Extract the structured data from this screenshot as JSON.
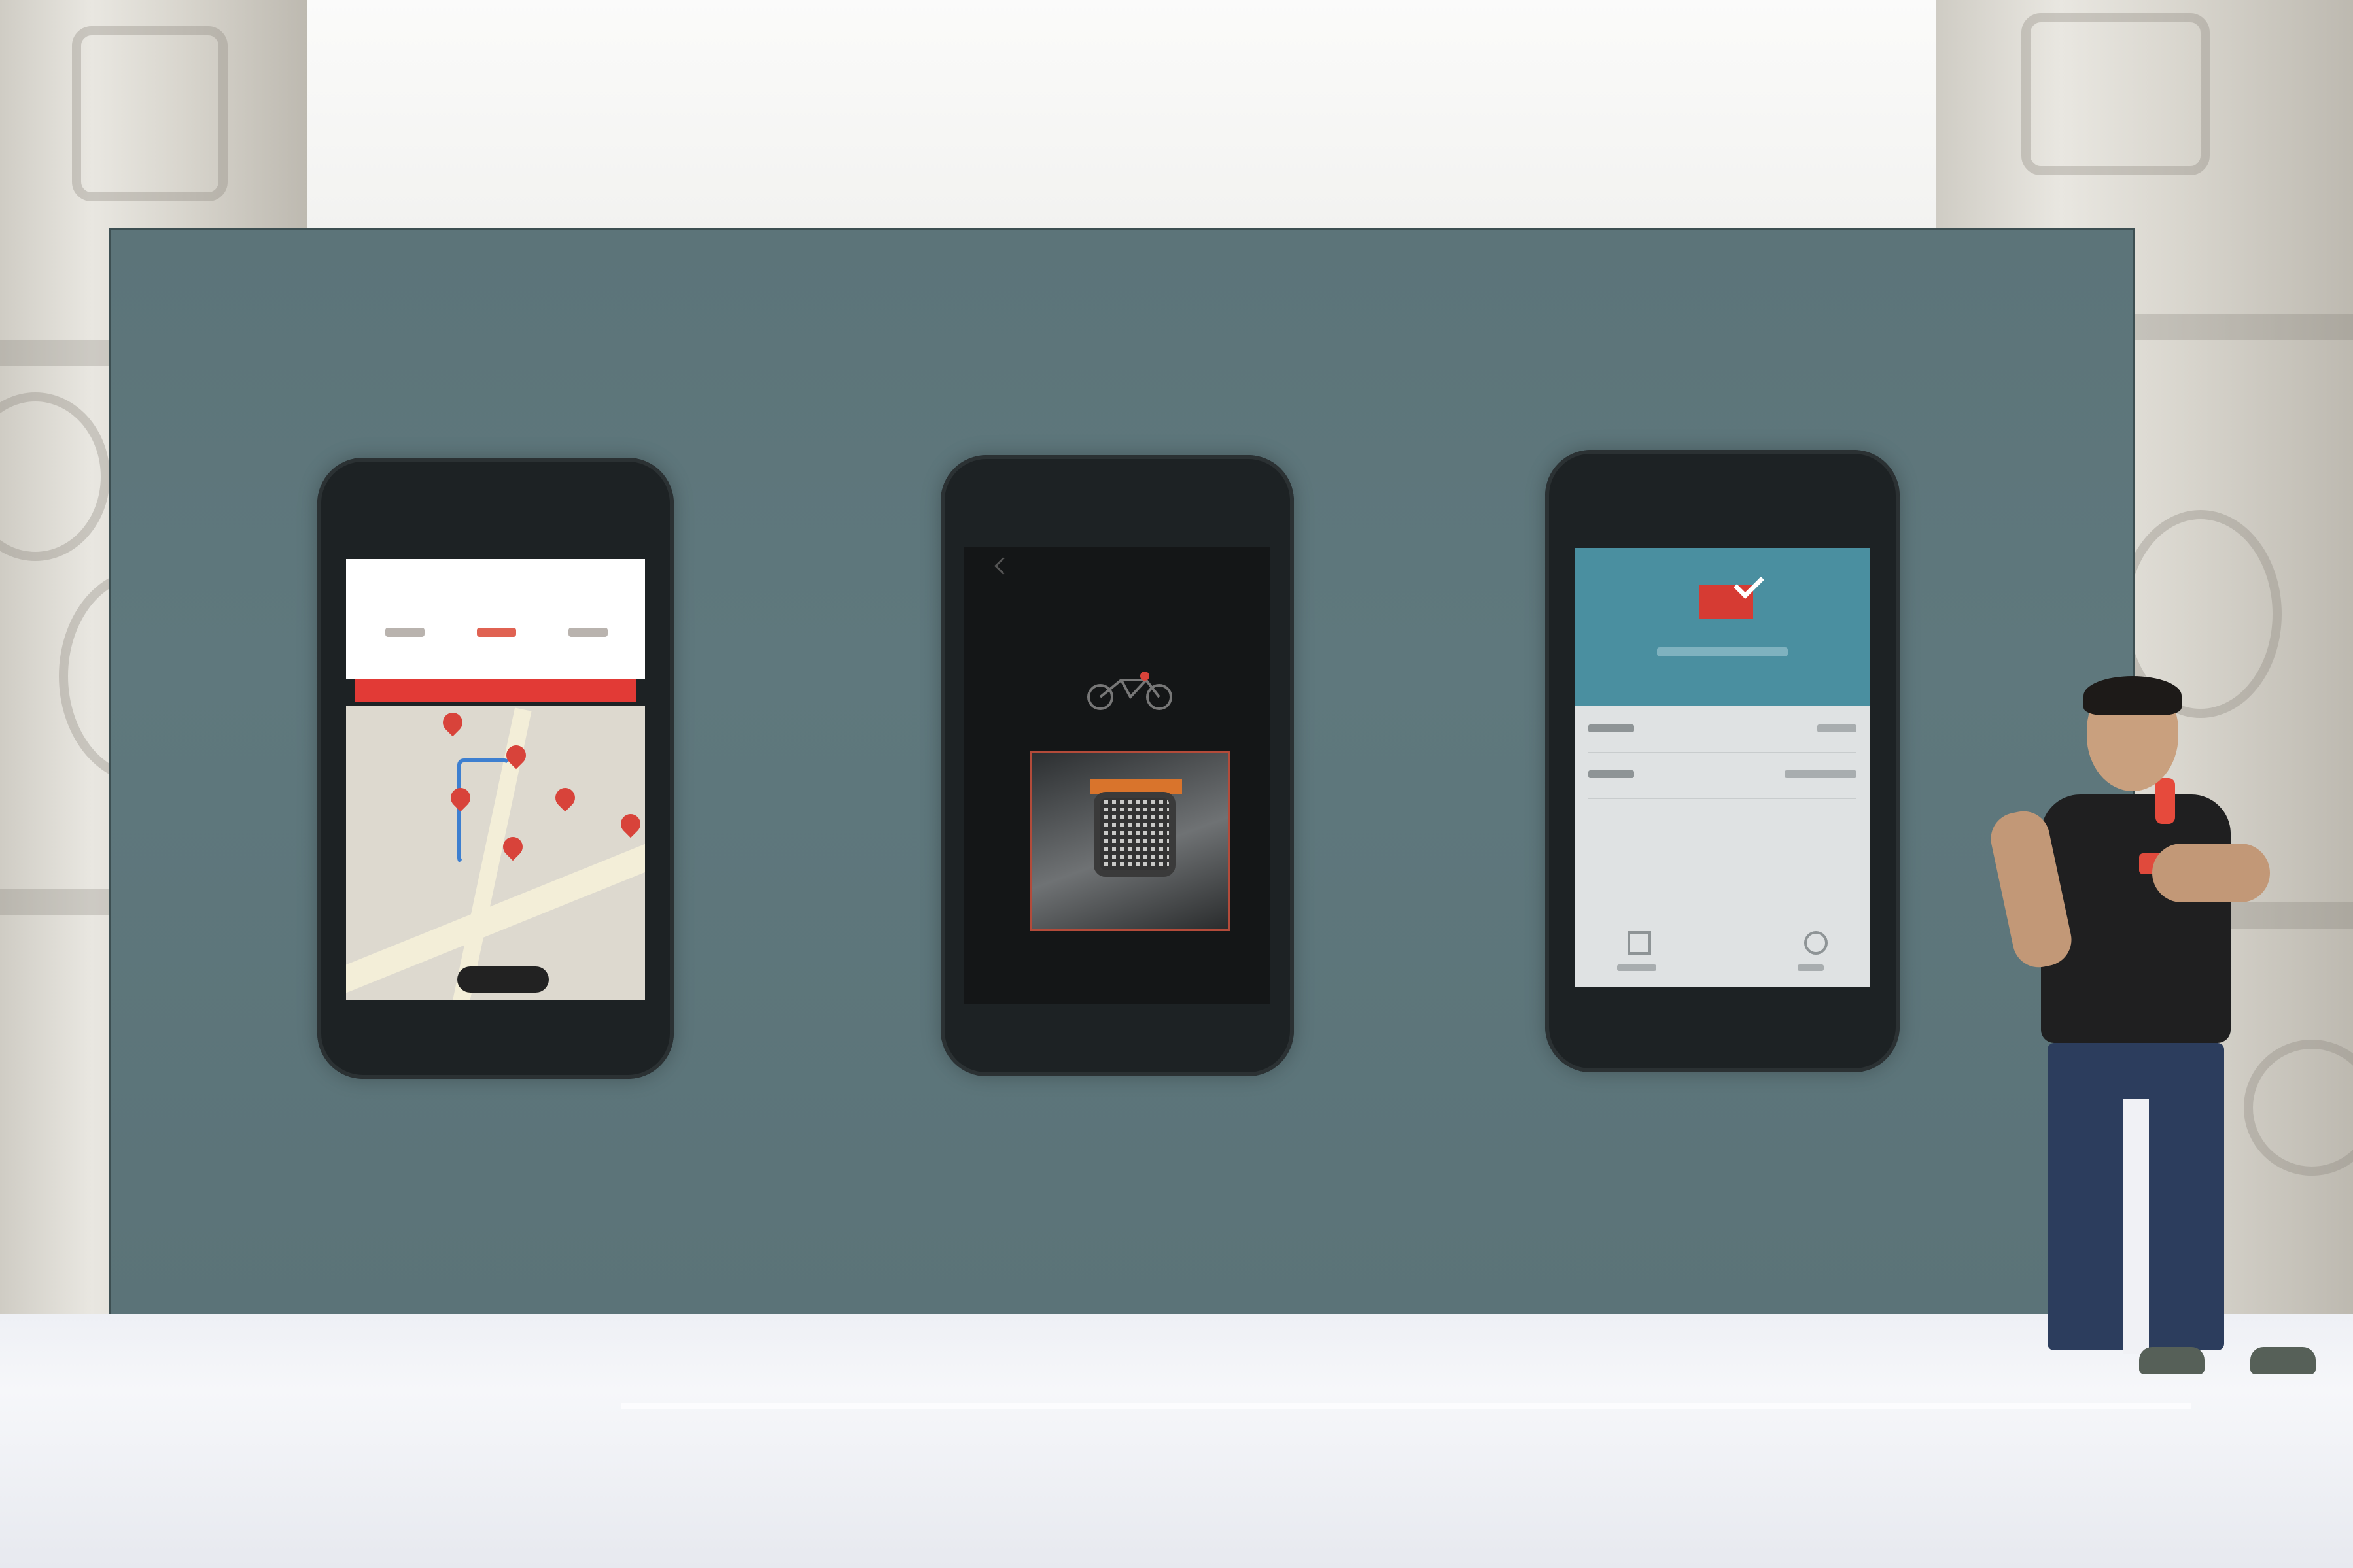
{
  "scene": {
    "description_free": true
  },
  "slide": {
    "phones": [
      {
        "name": "map-screen"
      },
      {
        "name": "scan-screen"
      },
      {
        "name": "payment-screen"
      }
    ]
  },
  "colors": {
    "brand_red": "#e23a36",
    "screen_bg": "#5c7479",
    "pay_header": "#4a8fa0"
  },
  "icons": [
    "location-pin-icon",
    "bike-icon",
    "qr-code-icon",
    "check-icon",
    "share-icon"
  ]
}
